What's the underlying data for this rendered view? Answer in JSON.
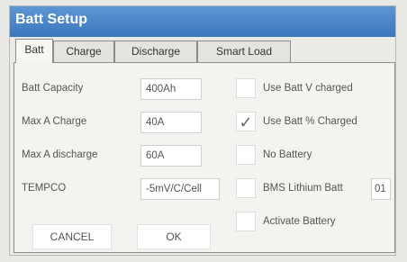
{
  "window": {
    "title": "Batt Setup"
  },
  "tabs": [
    {
      "label": "Batt"
    },
    {
      "label": "Charge"
    },
    {
      "label": "Discharge"
    },
    {
      "label": "Smart Load"
    }
  ],
  "fields": [
    {
      "label": "Batt Capacity",
      "value": "400Ah"
    },
    {
      "label": "Max A Charge",
      "value": "40A"
    },
    {
      "label": "Max A discharge",
      "value": "60A"
    },
    {
      "label": "TEMPCO",
      "value": "-5mV/C/Cell"
    }
  ],
  "options": [
    {
      "label": "Use Batt V charged",
      "checked": false
    },
    {
      "label": "Use Batt % Charged",
      "checked": true
    },
    {
      "label": "No Battery",
      "checked": false
    },
    {
      "label": "BMS Lithium Batt",
      "checked": false,
      "value": "01"
    },
    {
      "label": "Activate Battery",
      "checked": false
    }
  ],
  "buttons": {
    "cancel": "CANCEL",
    "ok": "OK"
  },
  "icons": {
    "check": "✓"
  },
  "colors": {
    "title_bar": "#3b76bf",
    "title_text": "#ffffff"
  }
}
